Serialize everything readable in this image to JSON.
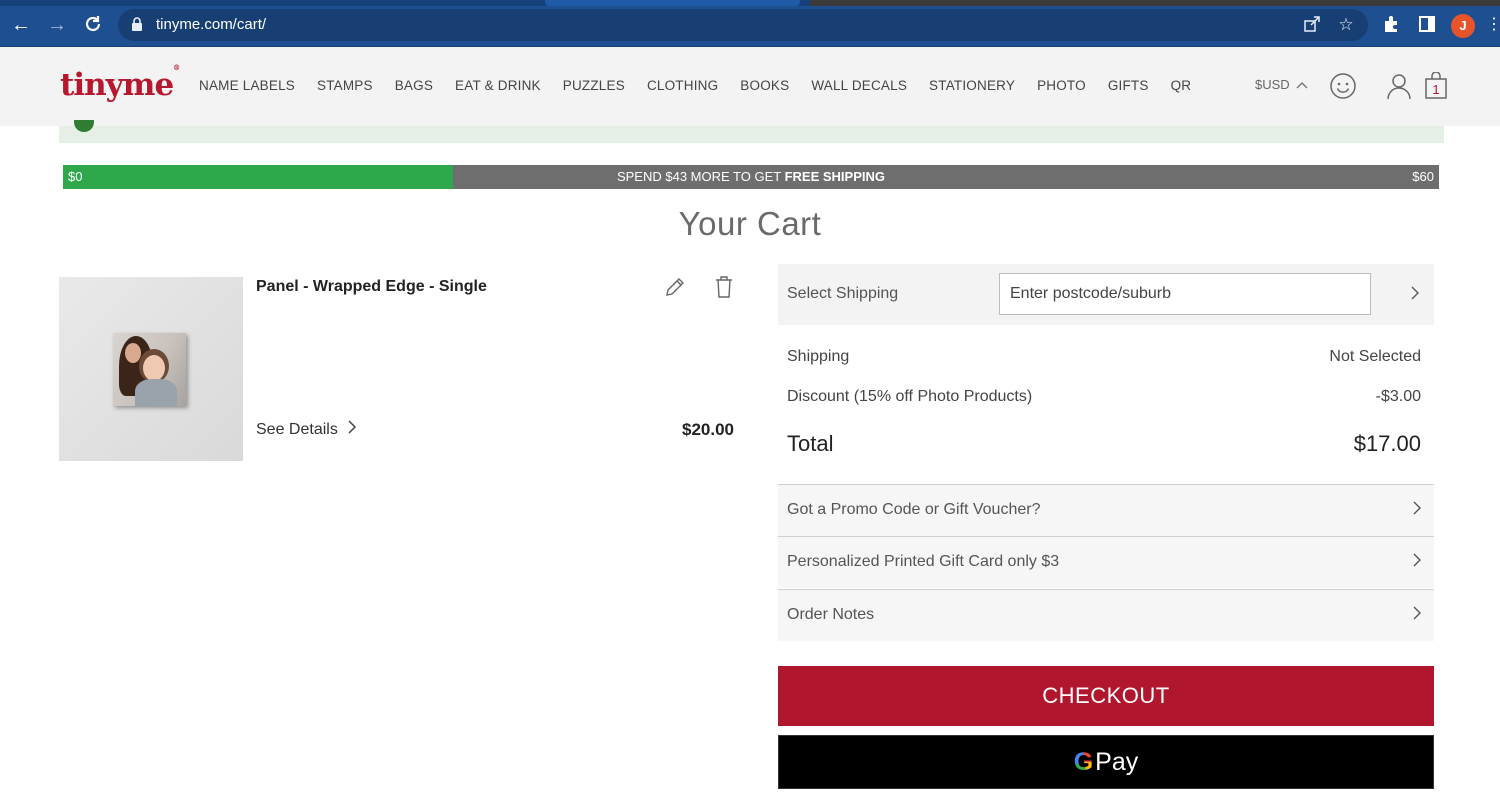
{
  "browser": {
    "url": "tinyme.com/cart/",
    "profile_initial": "J"
  },
  "header": {
    "logo": "tinyme",
    "logo_mark": "®",
    "nav": [
      "NAME LABELS",
      "STAMPS",
      "BAGS",
      "EAT & DRINK",
      "PUZZLES",
      "CLOTHING",
      "BOOKS",
      "WALL DECALS",
      "STATIONERY",
      "PHOTO",
      "GIFTS",
      "QR"
    ],
    "currency": "$USD",
    "cart_count": "1"
  },
  "shipping_progress": {
    "min_label": "$0",
    "max_label": "$60",
    "message_prefix": "SPEND $43 MORE TO GET ",
    "message_bold": "FREE SHIPPING",
    "progress_fraction": 0.2833
  },
  "page_title": "Your Cart",
  "cart_item": {
    "name": "Panel - Wrapped Edge - Single",
    "see_details": "See Details",
    "price": "$20.00"
  },
  "summary": {
    "select_shipping_label": "Select Shipping",
    "postcode_placeholder": "Enter postcode/suburb",
    "shipping_label": "Shipping",
    "shipping_value": "Not Selected",
    "discount_label": "Discount (15% off Photo Products)",
    "discount_value": "-$3.00",
    "total_label": "Total",
    "total_value": "$17.00",
    "promo_label": "Got a Promo Code or Gift Voucher?",
    "gift_card_label": "Personalized Printed Gift Card only $3",
    "order_notes_label": "Order Notes",
    "checkout_label": "CHECKOUT",
    "gpay_g": "G",
    "gpay_pay": "Pay"
  },
  "colors": {
    "brand": "#b5182f",
    "checkout": "#b0172e",
    "progress_fill": "#2ea84a",
    "progress_track": "#6e6e6e",
    "browser_chrome": "#1d4f91"
  }
}
